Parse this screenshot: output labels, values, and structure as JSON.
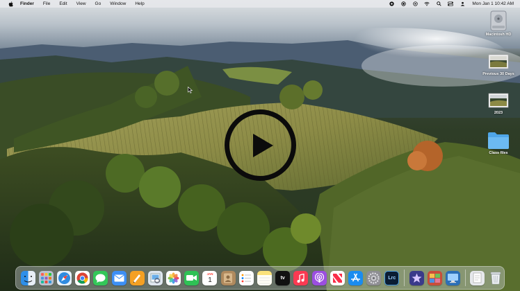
{
  "menubar": {
    "apple_icon": "apple-logo-icon",
    "items": [
      "Finder",
      "File",
      "Edit",
      "View",
      "Go",
      "Window",
      "Help"
    ],
    "status_icons": [
      "focus-icon",
      "record-icon",
      "siri-icon",
      "wifi-icon",
      "search-icon",
      "control-center-icon",
      "user-icon"
    ],
    "clock": "Mon Jan 1  10:42 AM"
  },
  "desktop": {
    "items": [
      {
        "label": "Macintosh HD",
        "icon": "hard-drive-icon"
      },
      {
        "label": "Previous 30 Days",
        "icon": "photo-icon"
      },
      {
        "label": "2023",
        "icon": "photo-icon"
      },
      {
        "label": "Class files",
        "icon": "folder-icon"
      }
    ]
  },
  "overlay": {
    "icon": "play-icon"
  },
  "dock": {
    "apps": [
      {
        "name": "finder-icon",
        "color": "#2f8fe8"
      },
      {
        "name": "launchpad-icon",
        "color": "#b9c2d0"
      },
      {
        "name": "safari-icon",
        "color": "#e8f2fb"
      },
      {
        "name": "chrome-icon",
        "color": "#ffffff"
      },
      {
        "name": "messages-icon",
        "color": "#34c759"
      },
      {
        "name": "mail-icon",
        "color": "#3d8ff5"
      },
      {
        "name": "pages-icon",
        "color": "#f5a023"
      },
      {
        "name": "preview-icon",
        "color": "#dfe6ee"
      },
      {
        "name": "photos-icon",
        "color": "#ffffff"
      },
      {
        "name": "facetime-icon",
        "color": "#2fc155"
      },
      {
        "name": "calendar-icon",
        "color": "#ffffff"
      },
      {
        "name": "contacts-icon",
        "color": "#b08a5e"
      },
      {
        "name": "reminders-icon",
        "color": "#ffffff"
      },
      {
        "name": "notes-icon",
        "color": "#fbe27a"
      },
      {
        "name": "apple-tv-icon",
        "color": "#111111"
      },
      {
        "name": "music-icon",
        "color": "#fb3a52"
      },
      {
        "name": "podcasts-icon",
        "color": "#9b4ee0"
      },
      {
        "name": "news-icon",
        "color": "#ffffff"
      },
      {
        "name": "app-store-icon",
        "color": "#1a8cf0"
      },
      {
        "name": "system-settings-icon",
        "color": "#8e8e93"
      },
      {
        "name": "lightroom-classic-icon",
        "color": "#0a1d33"
      }
    ],
    "calendar": {
      "month": "JAN",
      "day": "1"
    },
    "tv_label": "tv",
    "lrc_label": "Lrc",
    "after_separator": [
      {
        "name": "imovie-icon",
        "color": "#3a3a8a"
      },
      {
        "name": "photo-booth-icon",
        "color": "#c94d3a"
      },
      {
        "name": "screen-sharing-icon",
        "color": "#2c6fb7"
      }
    ],
    "trailing": [
      {
        "name": "downloads-stack-icon",
        "color": "#e6e8ec"
      },
      {
        "name": "trash-icon",
        "color": "#d9dde2"
      }
    ]
  }
}
